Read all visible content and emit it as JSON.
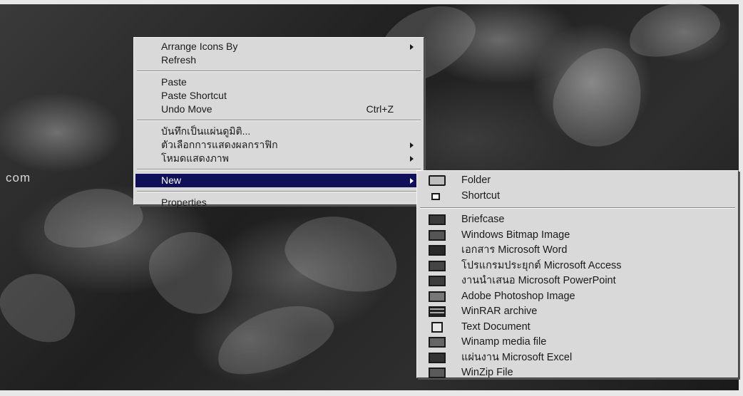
{
  "desktop": {
    "partial_text": "com"
  },
  "context_menu": {
    "items": [
      {
        "label": "Arrange Icons By",
        "submenu": true
      },
      {
        "label": "Refresh"
      },
      {
        "label": "Paste"
      },
      {
        "label": "Paste Shortcut"
      },
      {
        "label": "Undo Move",
        "shortcut": "Ctrl+Z"
      },
      {
        "label": "บันทึกเป็นแผ่นดูมิติ...",
        "submenu": false
      },
      {
        "label": "ตัวเลือกการแสดงผลกราฟิก",
        "submenu": true
      },
      {
        "label": "โหมดแสดงภาพ",
        "submenu": true
      },
      {
        "label": "New",
        "submenu": true,
        "selected": true
      },
      {
        "label": "Properties"
      }
    ]
  },
  "new_submenu": {
    "items": [
      {
        "label": "Folder",
        "icon": "folder-icon"
      },
      {
        "label": "Shortcut",
        "icon": "shortcut-icon"
      },
      {
        "label": "Briefcase",
        "icon": "briefcase-icon"
      },
      {
        "label": "Windows Bitmap Image",
        "icon": "bitmap-icon"
      },
      {
        "label": "เอกสาร Microsoft Word",
        "icon": "word-icon"
      },
      {
        "label": "โปรแกรมประยุกต์ Microsoft Access",
        "icon": "access-icon"
      },
      {
        "label": "งานนำเสนอ Microsoft PowerPoint",
        "icon": "powerpoint-icon"
      },
      {
        "label": "Adobe Photoshop Image",
        "icon": "photoshop-icon"
      },
      {
        "label": "WinRAR archive",
        "icon": "winrar-icon"
      },
      {
        "label": "Text Document",
        "icon": "text-document-icon"
      },
      {
        "label": "Winamp media file",
        "icon": "winamp-icon"
      },
      {
        "label": "แผ่นงาน Microsoft Excel",
        "icon": "excel-icon"
      },
      {
        "label": "WinZip File",
        "icon": "winzip-icon"
      }
    ]
  },
  "colors": {
    "menu_bg": "#d9d9d9",
    "highlight": "#10105a",
    "text": "#1a1a1a"
  }
}
